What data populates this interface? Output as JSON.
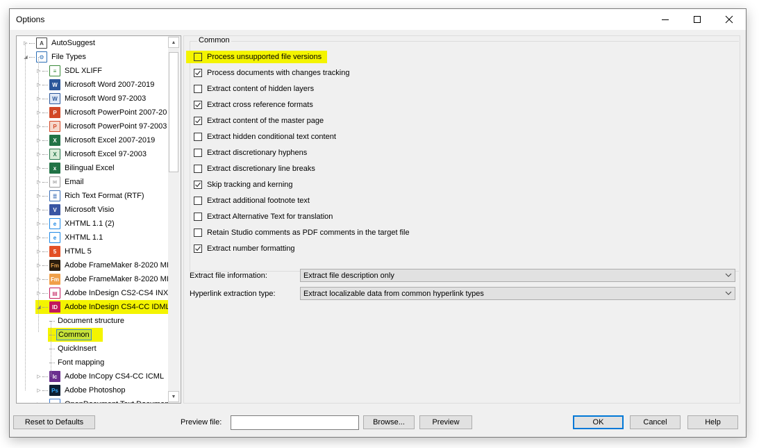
{
  "window": {
    "title": "Options",
    "minimize_icon": "minimize-icon",
    "maximize_icon": "maximize-icon",
    "close_icon": "close-icon"
  },
  "tree": {
    "items": [
      {
        "label": "AutoSuggest",
        "icon": "autosuggest-icon",
        "level": 0,
        "expander": "collapsed"
      },
      {
        "label": "File Types",
        "icon": "gear-document-icon",
        "level": 0,
        "expander": "expanded"
      },
      {
        "label": "SDL XLIFF",
        "icon": "xliff-icon",
        "level": 1,
        "expander": "collapsed"
      },
      {
        "label": "Microsoft Word 2007-2019",
        "icon": "word-icon",
        "level": 1,
        "expander": "collapsed"
      },
      {
        "label": "Microsoft Word 97-2003",
        "icon": "word-legacy-icon",
        "level": 1,
        "expander": "collapsed"
      },
      {
        "label": "Microsoft PowerPoint 2007-20",
        "icon": "powerpoint-icon",
        "level": 1,
        "expander": "collapsed"
      },
      {
        "label": "Microsoft PowerPoint 97-2003",
        "icon": "powerpoint-legacy-icon",
        "level": 1,
        "expander": "collapsed"
      },
      {
        "label": "Microsoft Excel 2007-2019",
        "icon": "excel-icon",
        "level": 1,
        "expander": "collapsed"
      },
      {
        "label": "Microsoft Excel 97-2003",
        "icon": "excel-legacy-icon",
        "level": 1,
        "expander": "collapsed"
      },
      {
        "label": "Bilingual Excel",
        "icon": "bilingual-excel-icon",
        "level": 1,
        "expander": "collapsed"
      },
      {
        "label": "Email",
        "icon": "email-icon",
        "level": 1,
        "expander": "collapsed"
      },
      {
        "label": "Rich Text Format (RTF)",
        "icon": "rtf-icon",
        "level": 1,
        "expander": "collapsed"
      },
      {
        "label": "Microsoft Visio",
        "icon": "visio-icon",
        "level": 1,
        "expander": "collapsed"
      },
      {
        "label": "XHTML 1.1 (2)",
        "icon": "ie-icon",
        "level": 1,
        "expander": "collapsed"
      },
      {
        "label": "XHTML 1.1",
        "icon": "ie-icon",
        "level": 1,
        "expander": "collapsed"
      },
      {
        "label": "HTML 5",
        "icon": "html5-icon",
        "level": 1,
        "expander": "collapsed"
      },
      {
        "label": "Adobe FrameMaker 8-2020 MI",
        "icon": "framemaker-icon",
        "level": 1,
        "expander": "collapsed"
      },
      {
        "label": "Adobe FrameMaker 8-2020 MI",
        "icon": "framemaker-alt-icon",
        "level": 1,
        "expander": "collapsed"
      },
      {
        "label": "Adobe InDesign CS2-CS4 INX",
        "icon": "indesign-inx-icon",
        "level": 1,
        "expander": "collapsed"
      },
      {
        "label": "Adobe InDesign CS4-CC IDML",
        "icon": "indesign-icon",
        "level": 1,
        "expander": "expanded",
        "highlighted": true
      },
      {
        "label": "Document structure",
        "level": 2
      },
      {
        "label": "Common",
        "level": 2,
        "selected": true,
        "highlighted": true
      },
      {
        "label": "QuickInsert",
        "level": 2
      },
      {
        "label": "Font mapping",
        "level": 2
      },
      {
        "label": "Adobe InCopy CS4-CC ICML",
        "icon": "incopy-icon",
        "level": 1,
        "expander": "collapsed"
      },
      {
        "label": "Adobe Photoshop",
        "icon": "photoshop-icon",
        "level": 1,
        "expander": "collapsed"
      },
      {
        "label": "OpenDocument Text Document",
        "icon": "opendocument-icon",
        "level": 1,
        "expander": "collapsed"
      }
    ]
  },
  "common": {
    "group_label": "Common",
    "options": [
      {
        "label": "Process unsupported file versions",
        "checked": false,
        "highlighted": true
      },
      {
        "label": "Process documents with changes tracking",
        "checked": true
      },
      {
        "label": "Extract content of hidden layers",
        "checked": false
      },
      {
        "label": "Extract cross reference formats",
        "checked": true
      },
      {
        "label": "Extract content of the master page",
        "checked": true
      },
      {
        "label": "Extract hidden conditional text content",
        "checked": false
      },
      {
        "label": "Extract discretionary hyphens",
        "checked": false
      },
      {
        "label": "Extract discretionary line breaks",
        "checked": false
      },
      {
        "label": "Skip tracking and kerning",
        "checked": true
      },
      {
        "label": "Extract additional footnote text",
        "checked": false
      },
      {
        "label": "Extract Alternative Text for translation",
        "checked": false
      },
      {
        "label": "Retain Studio comments as PDF comments in the target file",
        "checked": false
      },
      {
        "label": "Extract number formatting",
        "checked": true
      }
    ],
    "file_info_label": "Extract file information:",
    "file_info_value": "Extract file description only",
    "hyperlink_label": "Hyperlink extraction type:",
    "hyperlink_value": "Extract localizable data from common hyperlink types"
  },
  "footer": {
    "reset_label": "Reset to Defaults",
    "preview_file_label": "Preview file:",
    "preview_file_value": "",
    "browse_label": "Browse...",
    "preview_label": "Preview",
    "ok_label": "OK",
    "cancel_label": "Cancel",
    "help_label": "Help"
  },
  "colors": {
    "highlight": "#f4f400",
    "selection_border": "#3b8ac8",
    "default_button_border": "#0078d7"
  }
}
